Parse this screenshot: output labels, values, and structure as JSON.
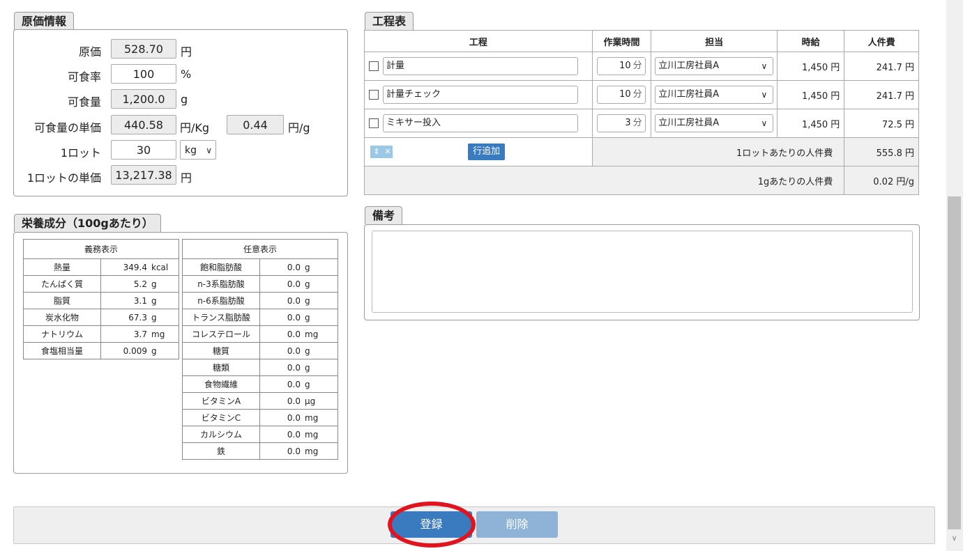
{
  "cost": {
    "tab": "原価情報",
    "rows": {
      "genka": {
        "label": "原価",
        "value": "528.70",
        "unit": "円"
      },
      "kashoku_ritsu": {
        "label": "可食率",
        "value": "100",
        "unit": "%"
      },
      "kashoku_ryo": {
        "label": "可食量",
        "value": "1,200.0",
        "unit": "g"
      },
      "tanka": {
        "label": "可食量の単価",
        "value": "440.58",
        "unit": "円/Kg",
        "value2": "0.44",
        "unit2": "円/g"
      },
      "lot": {
        "label": "1ロット",
        "value": "30",
        "unit_select": "kg"
      },
      "lot_tanka": {
        "label": "1ロットの単価",
        "value": "13,217.38",
        "unit": "円"
      }
    }
  },
  "nutrition": {
    "tab": "栄養成分（100gあたり）",
    "mandatory": {
      "header": "義務表示",
      "rows": [
        {
          "name": "熱量",
          "value": "349.4",
          "unit": "kcal"
        },
        {
          "name": "たんぱく質",
          "value": "5.2",
          "unit": "g"
        },
        {
          "name": "脂質",
          "value": "3.1",
          "unit": "g"
        },
        {
          "name": "炭水化物",
          "value": "67.3",
          "unit": "g"
        },
        {
          "name": "ナトリウム",
          "value": "3.7",
          "unit": "mg"
        },
        {
          "name": "食塩相当量",
          "value": "0.009",
          "unit": "g"
        }
      ]
    },
    "optional": {
      "header": "任意表示",
      "rows": [
        {
          "name": "飽和脂肪酸",
          "value": "0.0",
          "unit": "g"
        },
        {
          "name": "n-3系脂肪酸",
          "value": "0.0",
          "unit": "g"
        },
        {
          "name": "n-6系脂肪酸",
          "value": "0.0",
          "unit": "g"
        },
        {
          "name": "トランス脂肪酸",
          "value": "0.0",
          "unit": "g"
        },
        {
          "name": "コレステロール",
          "value": "0.0",
          "unit": "mg"
        },
        {
          "name": "糖質",
          "value": "0.0",
          "unit": "g"
        },
        {
          "name": "糖類",
          "value": "0.0",
          "unit": "g"
        },
        {
          "name": "食物繊維",
          "value": "0.0",
          "unit": "g"
        },
        {
          "name": "ビタミンA",
          "value": "0.0",
          "unit": "μg"
        },
        {
          "name": "ビタミンC",
          "value": "0.0",
          "unit": "mg"
        },
        {
          "name": "カルシウム",
          "value": "0.0",
          "unit": "mg"
        },
        {
          "name": "鉄",
          "value": "0.0",
          "unit": "mg"
        }
      ]
    }
  },
  "process": {
    "tab": "工程表",
    "headers": {
      "process": "工程",
      "time": "作業時間",
      "worker": "担当",
      "wage": "時給",
      "cost": "人件費"
    },
    "rows": [
      {
        "name": "計量",
        "time": "10",
        "time_unit": "分",
        "worker": "立川工房社員A",
        "wage": "1,450 円",
        "cost": "241.7 円"
      },
      {
        "name": "計量チェック",
        "time": "10",
        "time_unit": "分",
        "worker": "立川工房社員A",
        "wage": "1,450 円",
        "cost": "241.7 円"
      },
      {
        "name": "ミキサー投入",
        "time": "3",
        "time_unit": "分",
        "worker": "立川工房社員A",
        "wage": "1,450 円",
        "cost": "72.5 円"
      }
    ],
    "add_row": "行追加",
    "lot_cost_label": "1ロットあたりの人件費",
    "lot_cost_value": "555.8 円",
    "gram_cost_label": "1gあたりの人件費",
    "gram_cost_value": "0.02 円/g"
  },
  "notes": {
    "tab": "備考",
    "value": ""
  },
  "footer": {
    "register": "登録",
    "delete": "削除"
  },
  "colors": {
    "primary": "#3a7bbf",
    "primary_disabled": "#8fb3d6",
    "highlight": "#e0141e"
  }
}
